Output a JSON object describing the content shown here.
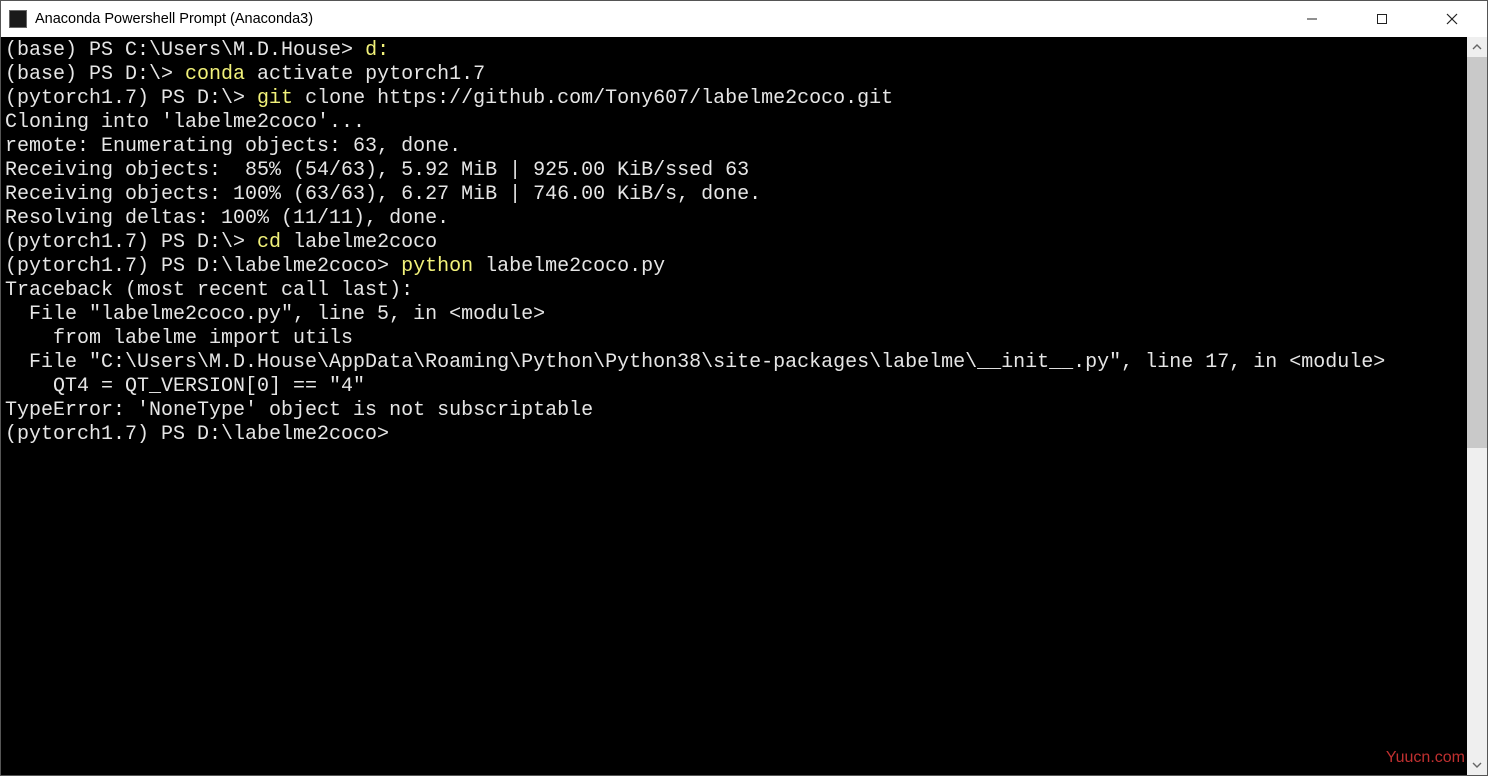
{
  "window": {
    "title": "Anaconda Powershell Prompt (Anaconda3)"
  },
  "scrollbar": {
    "thumb_height_percent": 56
  },
  "watermark": "Yuucn.com",
  "terminal": {
    "lines": [
      {
        "segments": [
          {
            "t": "(base) PS C:\\Users\\M.D.House> "
          },
          {
            "t": "d:",
            "cls": "hl-yellow"
          }
        ]
      },
      {
        "segments": [
          {
            "t": "(base) PS D:\\> "
          },
          {
            "t": "conda",
            "cls": "hl-yellow"
          },
          {
            "t": " activate pytorch1.7"
          }
        ]
      },
      {
        "segments": [
          {
            "t": "(pytorch1.7) PS D:\\> "
          },
          {
            "t": "git",
            "cls": "hl-yellow"
          },
          {
            "t": " clone https://github.com/Tony607/labelme2coco.git"
          }
        ]
      },
      {
        "segments": [
          {
            "t": "Cloning into 'labelme2coco'..."
          }
        ]
      },
      {
        "segments": [
          {
            "t": "remote: Enumerating objects: 63, done."
          }
        ]
      },
      {
        "segments": [
          {
            "t": "Receiving objects:  85% (54/63), 5.92 MiB | 925.00 KiB/ssed 63"
          }
        ]
      },
      {
        "segments": [
          {
            "t": "Receiving objects: 100% (63/63), 6.27 MiB | 746.00 KiB/s, done."
          }
        ]
      },
      {
        "segments": [
          {
            "t": "Resolving deltas: 100% (11/11), done."
          }
        ]
      },
      {
        "segments": [
          {
            "t": "(pytorch1.7) PS D:\\> "
          },
          {
            "t": "cd",
            "cls": "hl-yellow"
          },
          {
            "t": " labelme2coco"
          }
        ]
      },
      {
        "segments": [
          {
            "t": "(pytorch1.7) PS D:\\labelme2coco> "
          },
          {
            "t": "python",
            "cls": "hl-yellow"
          },
          {
            "t": " labelme2coco.py"
          }
        ]
      },
      {
        "segments": [
          {
            "t": "Traceback (most recent call last):"
          }
        ]
      },
      {
        "segments": [
          {
            "t": "  File \"labelme2coco.py\", line 5, in <module>"
          }
        ]
      },
      {
        "segments": [
          {
            "t": "    from labelme import utils"
          }
        ]
      },
      {
        "segments": [
          {
            "t": "  File \"C:\\Users\\M.D.House\\AppData\\Roaming\\Python\\Python38\\site-packages\\labelme\\__init__.py\", line 17, in <module>"
          }
        ]
      },
      {
        "segments": [
          {
            "t": "    QT4 = QT_VERSION[0] == \"4\""
          }
        ]
      },
      {
        "segments": [
          {
            "t": "TypeError: 'NoneType' object is not subscriptable"
          }
        ]
      },
      {
        "segments": [
          {
            "t": "(pytorch1.7) PS D:\\labelme2coco>"
          }
        ]
      }
    ]
  }
}
